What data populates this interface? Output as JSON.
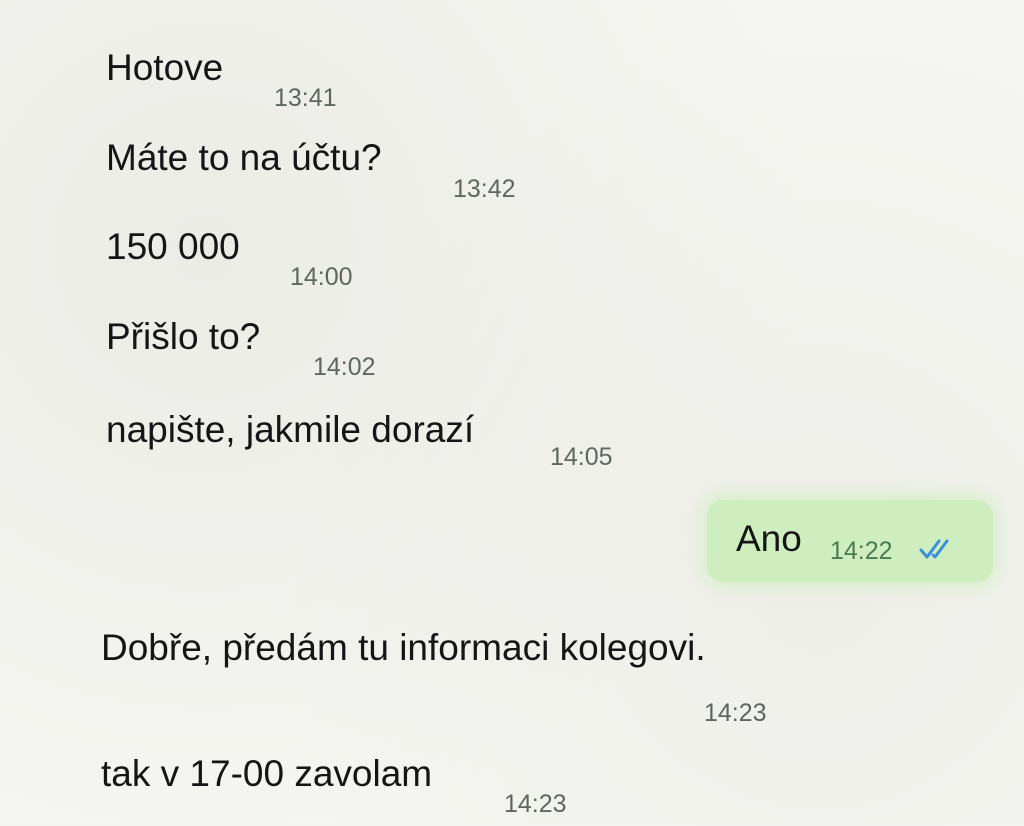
{
  "messages": [
    {
      "text": "Hotove",
      "time": "13:41"
    },
    {
      "text": "Máte to na účtu?",
      "time": "13:42"
    },
    {
      "text": "150 000",
      "time": "14:00"
    },
    {
      "text": "Přišlo to?",
      "time": "14:02"
    },
    {
      "text": "napište, jakmile dorazí",
      "time": "14:05"
    },
    {
      "text": "Ano",
      "time": "14:22",
      "outgoing": true,
      "status_icon": "double-check-read-icon"
    },
    {
      "text": "Dobře, předám tu informaci kolegovi.",
      "time": "14:23"
    },
    {
      "text": "tak v 17-00 zavolam",
      "time": "14:23"
    }
  ],
  "colors": {
    "outgoing_bubble": "#cfeec0",
    "read_ticks": "#3b8fd8",
    "timestamp": "#5f6660"
  }
}
